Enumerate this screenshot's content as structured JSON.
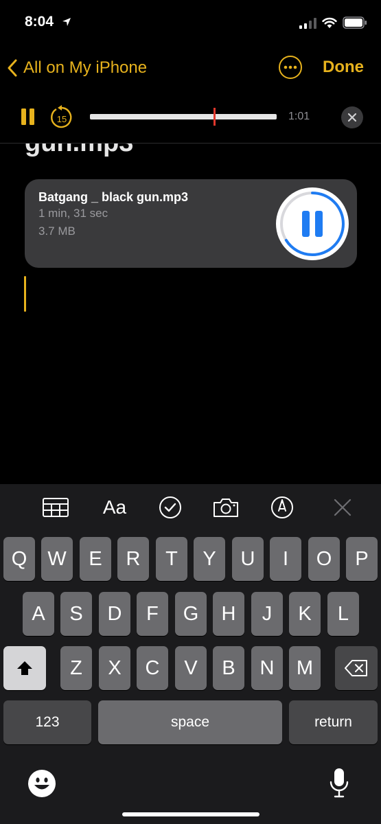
{
  "status_bar": {
    "time": "8:04"
  },
  "nav": {
    "back_label": "All on My iPhone",
    "done_label": "Done"
  },
  "player": {
    "elapsed": "1:01",
    "skip_seconds": "15",
    "progress": 0.66
  },
  "note": {
    "title_fragment": "gun.mp3",
    "attachment": {
      "file_name": "Batgang _ black gun.mp3",
      "duration": "1 min, 31 sec",
      "size": "3.7 MB",
      "playback_progress": 0.66
    }
  },
  "toolbar": {
    "items": [
      "table-icon",
      "format-text",
      "checklist-icon",
      "camera-icon",
      "markup-icon",
      "close-icon"
    ],
    "format_label": "Aa"
  },
  "keyboard": {
    "row1": [
      "Q",
      "W",
      "E",
      "R",
      "T",
      "Y",
      "U",
      "I",
      "O",
      "P"
    ],
    "row2": [
      "A",
      "S",
      "D",
      "F",
      "G",
      "H",
      "J",
      "K",
      "L"
    ],
    "row3": [
      "Z",
      "X",
      "C",
      "V",
      "B",
      "N",
      "M"
    ],
    "numbers_label": "123",
    "space_label": "space",
    "return_label": "return"
  },
  "colors": {
    "accent": "#e7b21d",
    "playhead": "#e2372c",
    "progress_ring": "#1f7cf2"
  }
}
